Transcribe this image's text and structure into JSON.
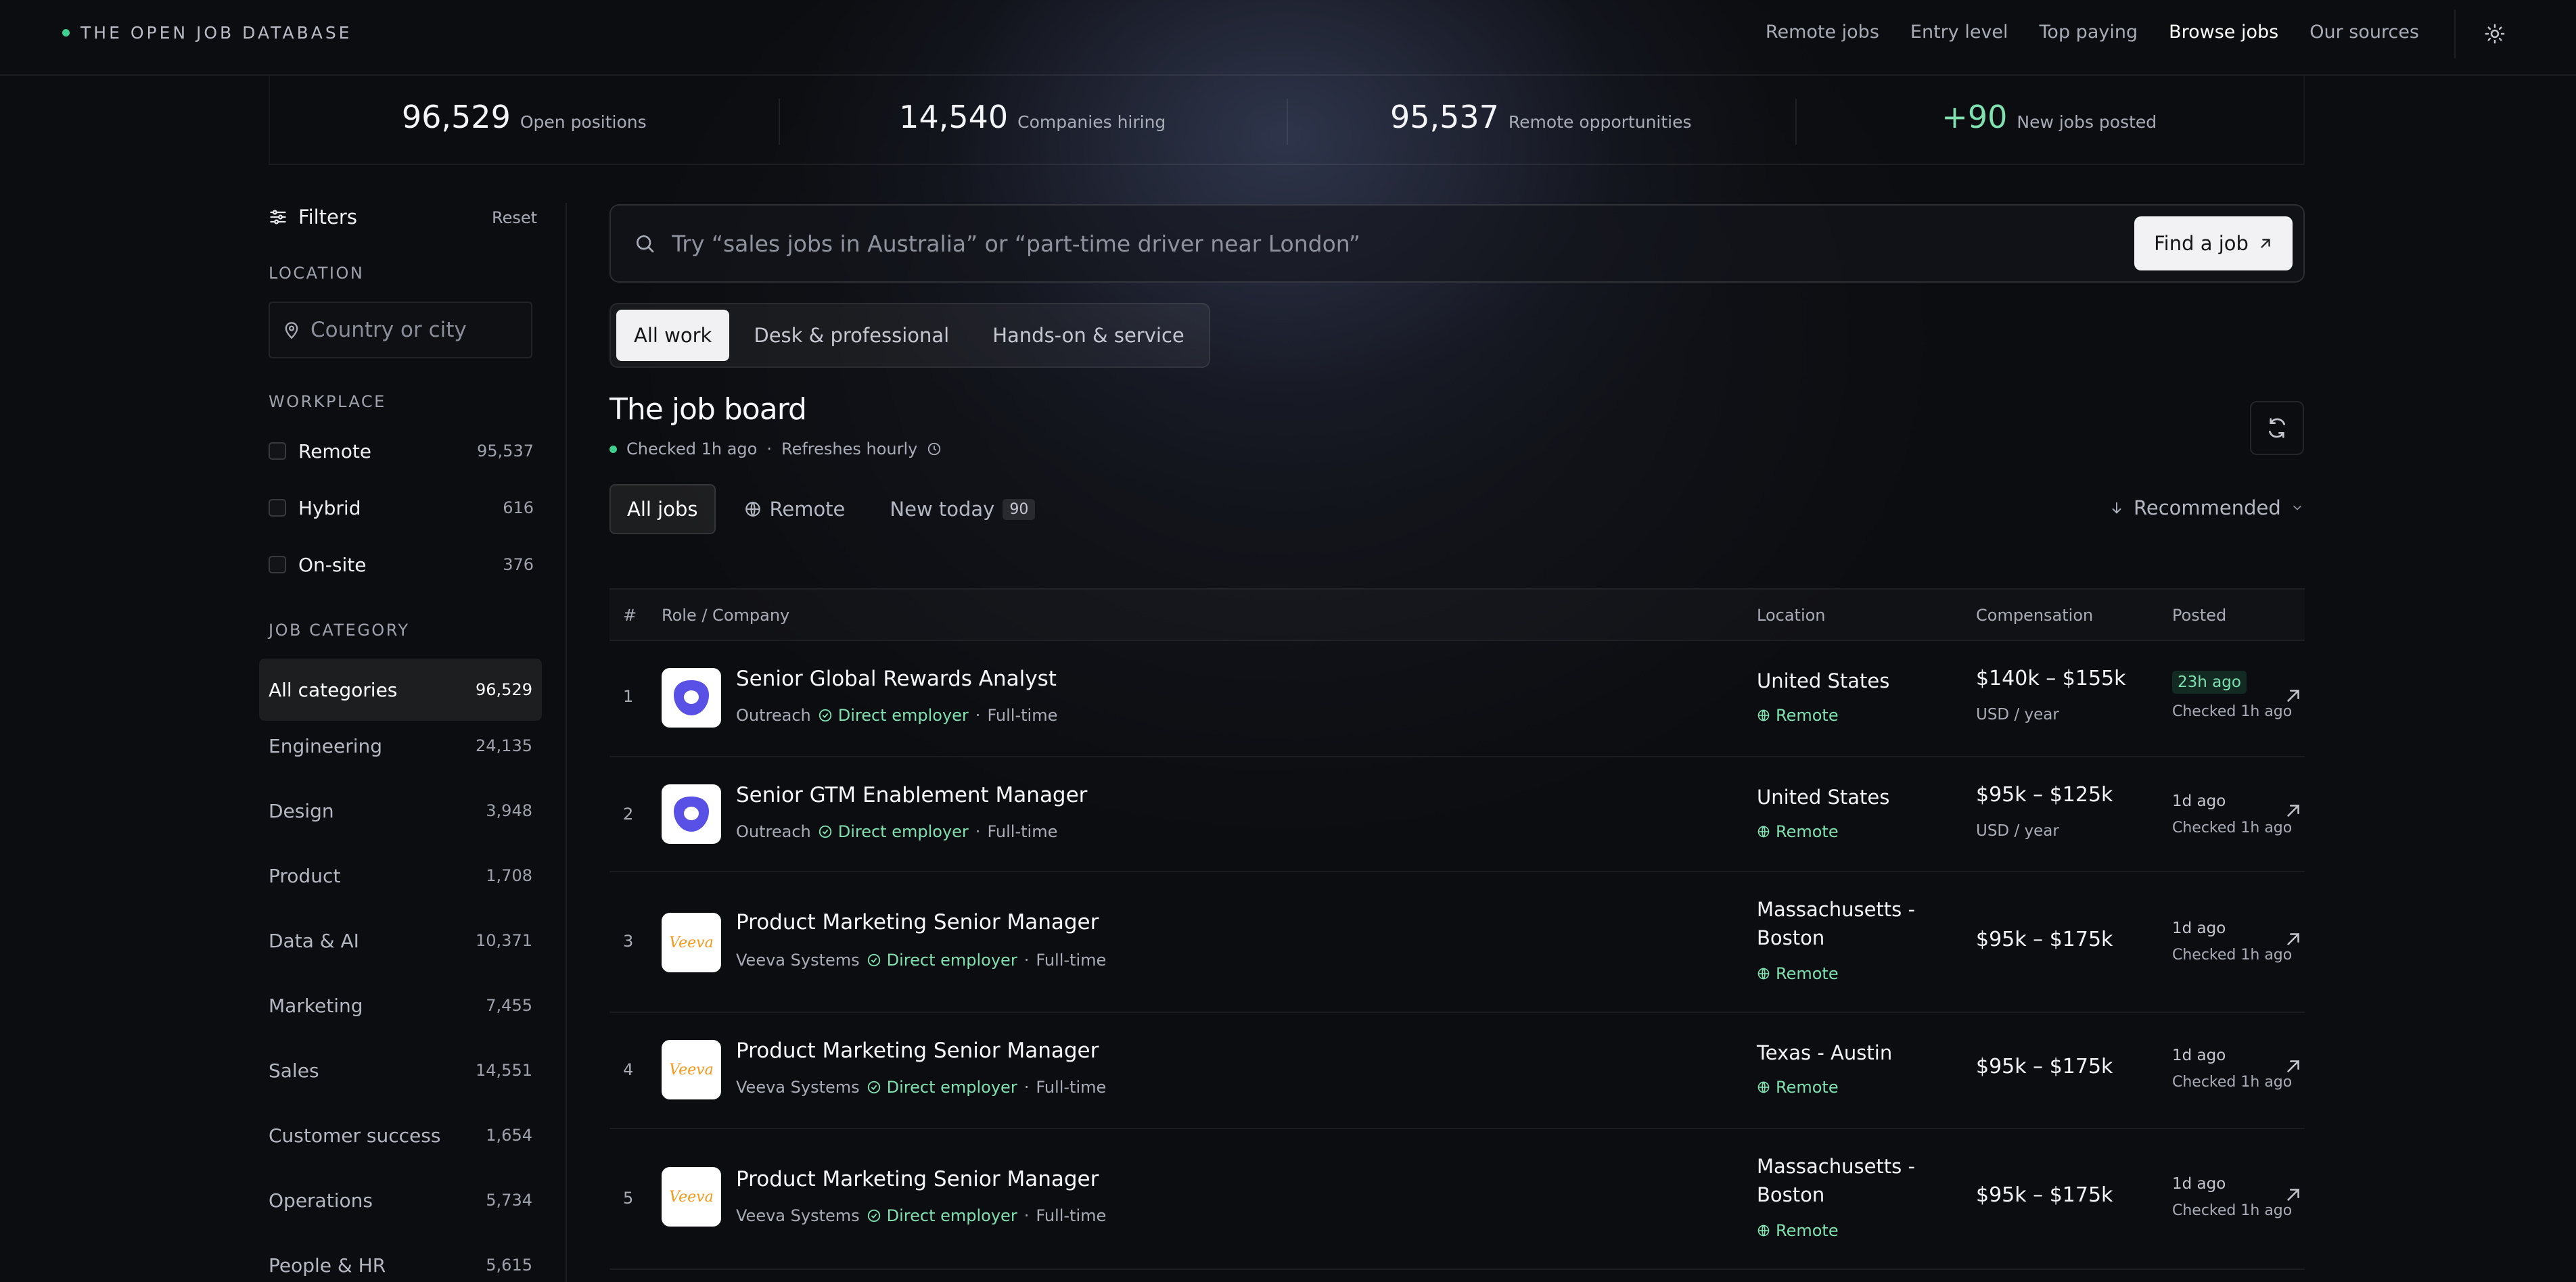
{
  "brand": "THE OPEN JOB DATABASE",
  "nav": [
    "Remote jobs",
    "Entry level",
    "Top paying",
    "Browse jobs",
    "Our sources"
  ],
  "stats": [
    {
      "value": "96,529",
      "label": "Open positions"
    },
    {
      "value": "14,540",
      "label": "Companies hiring"
    },
    {
      "value": "95,537",
      "label": "Remote opportunities"
    },
    {
      "value": "+90",
      "label": "New jobs posted"
    }
  ],
  "sidebar": {
    "title": "Filters",
    "reset": "Reset",
    "location_label": "LOCATION",
    "location_placeholder": "Country or city",
    "workplace_label": "WORKPLACE",
    "workplace": [
      {
        "label": "Remote",
        "count": "95,537"
      },
      {
        "label": "Hybrid",
        "count": "616"
      },
      {
        "label": "On-site",
        "count": "376"
      }
    ],
    "category_label": "JOB CATEGORY",
    "categories": [
      {
        "label": "All categories",
        "count": "96,529"
      },
      {
        "label": "Engineering",
        "count": "24,135"
      },
      {
        "label": "Design",
        "count": "3,948"
      },
      {
        "label": "Product",
        "count": "1,708"
      },
      {
        "label": "Data & AI",
        "count": "10,371"
      },
      {
        "label": "Marketing",
        "count": "7,455"
      },
      {
        "label": "Sales",
        "count": "14,551"
      },
      {
        "label": "Customer success",
        "count": "1,654"
      },
      {
        "label": "Operations",
        "count": "5,734"
      },
      {
        "label": "People & HR",
        "count": "5,615"
      }
    ]
  },
  "search": {
    "placeholder": "Try “sales jobs in Australia” or “part-time driver near London”",
    "button": "Find a job"
  },
  "segments": [
    "All work",
    "Desk & professional",
    "Hands-on & service"
  ],
  "board": {
    "title": "The job board",
    "checked": "Checked 1h ago",
    "refreshes": "Refreshes hourly"
  },
  "tabs": {
    "all": "All jobs",
    "remote": "Remote",
    "new_today": "New today",
    "new_today_count": "90",
    "sort": "Recommended"
  },
  "table": {
    "headers": {
      "num": "#",
      "role": "Role / Company",
      "location": "Location",
      "compensation": "Compensation",
      "posted": "Posted"
    },
    "rows": [
      {
        "num": "1",
        "role": "Senior Global Rewards Analyst",
        "company": "Outreach",
        "employer": "Direct employer",
        "type": "Full-time",
        "location": "United States",
        "remote": "Remote",
        "comp": "$140k – $155k",
        "unit": "USD / year",
        "posted": "23h ago",
        "checked": "Checked 1h ago"
      },
      {
        "num": "2",
        "role": "Senior GTM Enablement Manager",
        "company": "Outreach",
        "employer": "Direct employer",
        "type": "Full-time",
        "location": "United States",
        "remote": "Remote",
        "comp": "$95k – $125k",
        "unit": "USD / year",
        "posted": "1d ago",
        "checked": "Checked 1h ago"
      },
      {
        "num": "3",
        "role": "Product Marketing Senior Manager",
        "company": "Veeva Systems",
        "employer": "Direct employer",
        "type": "Full-time",
        "location": "Massachusetts - Boston",
        "remote": "Remote",
        "comp": "$95k – $175k",
        "unit": "",
        "posted": "1d ago",
        "checked": "Checked 1h ago"
      },
      {
        "num": "4",
        "role": "Product Marketing Senior Manager",
        "company": "Veeva Systems",
        "employer": "Direct employer",
        "type": "Full-time",
        "location": "Texas - Austin",
        "remote": "Remote",
        "comp": "$95k – $175k",
        "unit": "",
        "posted": "1d ago",
        "checked": "Checked 1h ago"
      },
      {
        "num": "5",
        "role": "Product Marketing Senior Manager",
        "company": "Veeva Systems",
        "employer": "Direct employer",
        "type": "Full-time",
        "location": "Massachusetts - Boston",
        "remote": "Remote",
        "comp": "$95k – $175k",
        "unit": "",
        "posted": "1d ago",
        "checked": "Checked 1h ago"
      }
    ]
  },
  "logos": {
    "outreach": "Outreach logo",
    "veeva_text": "Veeva"
  },
  "colors": {
    "accent_green": "#3fcf8e",
    "outreach_purple": "#5951e6",
    "veeva_orange": "#f39a1d"
  }
}
